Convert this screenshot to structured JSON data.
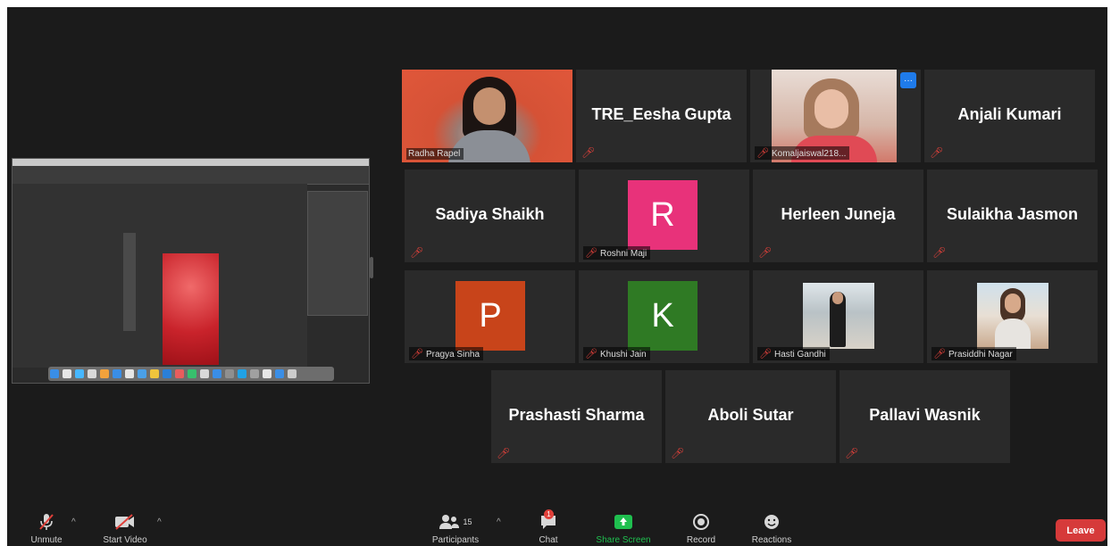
{
  "participants_grid": [
    {
      "display": "video",
      "label": "Radha Rapel",
      "active_speaker": true
    },
    {
      "display": "name",
      "name": "TRE_Eesha Gupta"
    },
    {
      "display": "video",
      "label": "Komaljaiswal218...",
      "has_more_button": true
    },
    {
      "display": "name",
      "name": "Anjali Kumari"
    },
    {
      "display": "name",
      "name": "Sadiya Shaikh"
    },
    {
      "display": "avatar",
      "initial": "R",
      "color": "#e8327a",
      "label": "Roshni Maji"
    },
    {
      "display": "name",
      "name": "Herleen Juneja"
    },
    {
      "display": "name",
      "name": "Sulaikha Jasmon"
    },
    {
      "display": "avatar",
      "initial": "P",
      "color": "#c8441a",
      "label": "Pragya Sinha"
    },
    {
      "display": "avatar",
      "initial": "K",
      "color": "#2f7a24",
      "label": "Khushi Jain"
    },
    {
      "display": "photo",
      "label": "Hasti Gandhi"
    },
    {
      "display": "photo",
      "label": "Prasiddhi Nagar"
    },
    {
      "display": "name",
      "name": "Prashasti Sharma"
    },
    {
      "display": "name",
      "name": "Aboli Sutar"
    },
    {
      "display": "name",
      "name": "Pallavi Wasnik"
    }
  ],
  "toolbar": {
    "unmute": "Unmute",
    "start_video": "Start Video",
    "participants": "Participants",
    "participants_count": "15",
    "chat": "Chat",
    "chat_badge": "1",
    "share_screen": "Share Screen",
    "record": "Record",
    "reactions": "Reactions",
    "leave": "Leave"
  },
  "colors": {
    "background": "#1b1b1b",
    "tile": "#2a2a2a",
    "active_border": "#f2e24a",
    "muted_icon": "#e0403a",
    "share_screen_green": "#1fbf4f",
    "leave_red": "#d63a3a"
  }
}
